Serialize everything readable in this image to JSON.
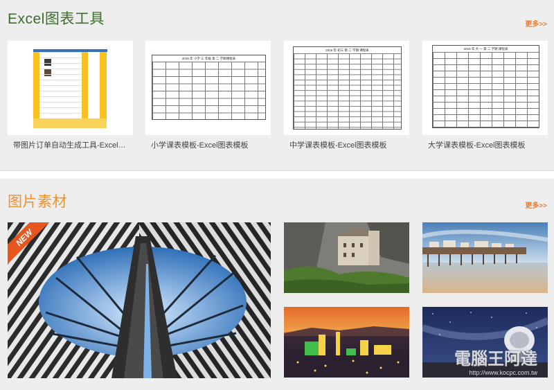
{
  "excel_section": {
    "title": "Excel图表工具",
    "more": "更多>>",
    "cards": [
      {
        "caption": "带图片订单自动生成工具-Excel图…"
      },
      {
        "caption": "小学课表模板-Excel图表模板",
        "sheet_title": "2016 年 小学 三 年级 第 二 学期课程表"
      },
      {
        "caption": "中学课表模板-Excel图表模板",
        "sheet_title": "2016 年 初三 第 二 学期 课程表"
      },
      {
        "caption": "大学课表模板-Excel图表模板",
        "sheet_title": "2016 年 大 一 第 二 学期 课程表"
      }
    ]
  },
  "image_section": {
    "title": "图片素材",
    "more": "更多>>",
    "new_badge": "NEW"
  },
  "watermark": {
    "site": "電腦王阿達",
    "url": "http://www.kocpc.com.tw"
  },
  "colors": {
    "excel_title": "#3d6e2c",
    "image_title": "#f0902f",
    "more_link": "#ee7a2b",
    "badge": "#e8561f"
  }
}
